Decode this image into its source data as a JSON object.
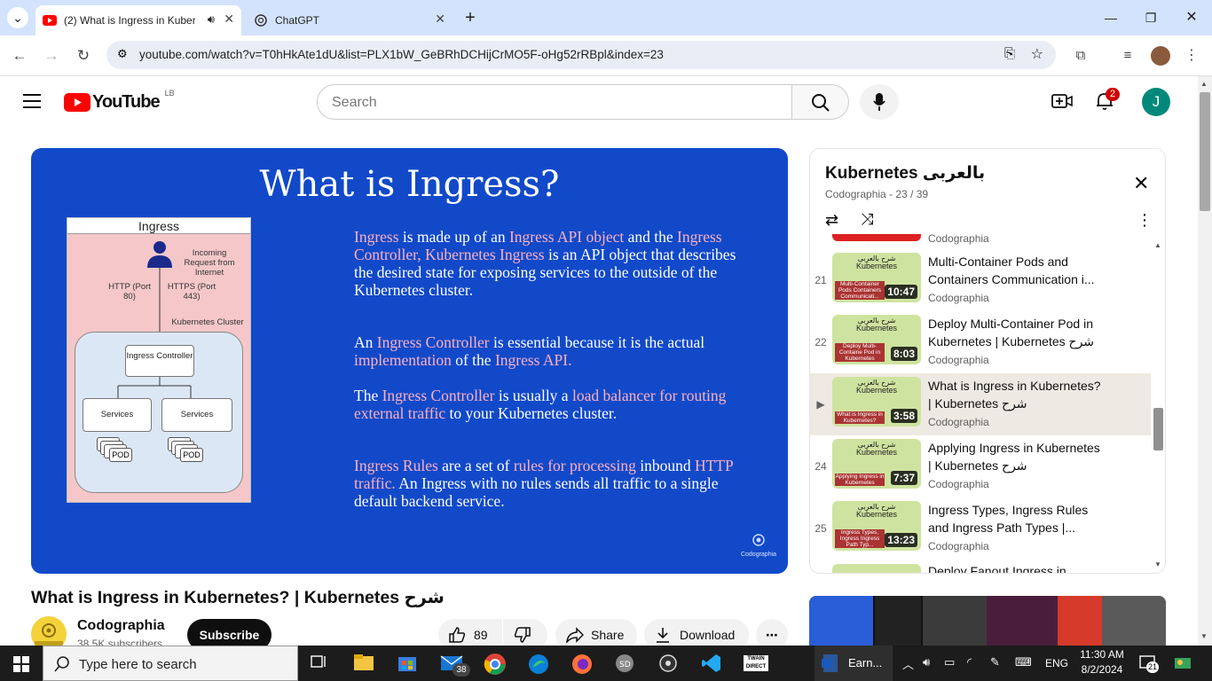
{
  "browser": {
    "tabs": [
      {
        "title": "(2) What is Ingress in Kuber",
        "active": true
      },
      {
        "title": "ChatGPT",
        "active": false
      }
    ],
    "url": "youtube.com/watch?v=T0hHkAte1dU&list=PLX1bW_GeBRhDCHijCrMO5F-oHg52rRBpl&index=23"
  },
  "youtube": {
    "logo_text": "YouTube",
    "region": "LB",
    "search_placeholder": "Search",
    "notifications_count": "2",
    "account_initial": "J"
  },
  "slide": {
    "title": "What is Ingress?",
    "diagram": {
      "header": "Ingress",
      "incoming": "Incoming Request from Internet",
      "http": "HTTP (Port 80)",
      "https": "HTTPS (Port 443)",
      "cluster": "Kubernetes Cluster",
      "controller": "Ingress Controller",
      "services": "Services",
      "pod": "POD"
    },
    "paragraphs": [
      [
        {
          "t": "Ingress",
          "h": true
        },
        {
          "t": " is made up of an ",
          "h": false
        },
        {
          "t": "Ingress API object",
          "h": true
        },
        {
          "t": " and the ",
          "h": false
        },
        {
          "t": "Ingress Controller, Kubernetes Ingress",
          "h": true
        },
        {
          "t": " is an API object that describes the desired state for exposing services to the outside of the Kubernetes cluster.",
          "h": false
        }
      ],
      [
        {
          "t": "An ",
          "h": false
        },
        {
          "t": "Ingress Controller",
          "h": true
        },
        {
          "t": " is essential because it is the actual ",
          "h": false
        },
        {
          "t": "implementation",
          "h": true
        },
        {
          "t": " of the ",
          "h": false
        },
        {
          "t": "Ingress API.",
          "h": true
        }
      ],
      [
        {
          "t": "The ",
          "h": false
        },
        {
          "t": "Ingress Controller",
          "h": true
        },
        {
          "t": " is usually a ",
          "h": false
        },
        {
          "t": "load balancer for routing external traffic",
          "h": true
        },
        {
          "t": " to your Kubernetes cluster.",
          "h": false
        }
      ],
      [
        {
          "t": "Ingress Rules",
          "h": true
        },
        {
          "t": " are a set of ",
          "h": false
        },
        {
          "t": "rules for processing",
          "h": true
        },
        {
          "t": " inbound ",
          "h": false
        },
        {
          "t": "HTTP traffic.",
          "h": true
        },
        {
          "t": " An Ingress with no rules sends all traffic to a single default backend service.",
          "h": false
        }
      ]
    ],
    "watermark": "Codographia"
  },
  "video": {
    "title": "What is Ingress in Kubernetes? | Kubernetes شرح",
    "channel": "Codographia",
    "subscribers": "38.5K subscribers",
    "subscribe_label": "Subscribe",
    "likes": "89",
    "share_label": "Share",
    "download_label": "Download"
  },
  "playlist": {
    "title": "Kubernetes بالعربى",
    "subtitle": "Codographia - 23 / 39",
    "partial_top_channel": "Codographia",
    "items": [
      {
        "index": "21",
        "title": "Multi-Container Pods and Containers Communication i...",
        "channel": "Codographia",
        "duration": "10:47",
        "thumb_caption": "Multi-Container Pods Containers Communicati..."
      },
      {
        "index": "22",
        "title": "Deploy Multi-Container Pod in Kubernetes | Kubernetes شرح",
        "channel": "Codographia",
        "duration": "8:03",
        "thumb_caption": "Deploy Multi-Containe Pod in Kubernetes"
      },
      {
        "index": "▶",
        "title": "What is Ingress in Kubernetes? | Kubernetes شرح",
        "channel": "Codographia",
        "duration": "3:58",
        "thumb_caption": "What is Ingress in Kubernetes?",
        "current": true
      },
      {
        "index": "24",
        "title": "Applying Ingress in Kubernetes | Kubernetes شرح",
        "channel": "Codographia",
        "duration": "7:37",
        "thumb_caption": "Applying Ingress in Kubernetes"
      },
      {
        "index": "25",
        "title": "Ingress Types, Ingress Rules and Ingress Path Types |...",
        "channel": "Codographia",
        "duration": "13:23",
        "thumb_caption": "Ingress Types, Ingress Ingress Path Typ..."
      }
    ],
    "partial_bottom_title": "Deploy Fanout Ingress in",
    "thumb_top_text": "شرح بالعربى",
    "thumb_sub_text": "Kubernetes"
  },
  "taskbar": {
    "search_placeholder": "Type here to search",
    "mail_badge": "38",
    "word_label": "Earn...",
    "language": "ENG",
    "time": "11:30 AM",
    "date": "8/2/2024",
    "notification_count": "21"
  },
  "colors": {
    "youtube_red": "#ff0000",
    "slide_blue": "#1149c9",
    "slide_highlight": "#ffb0c4",
    "chrome_tabbar": "#d3e3fd"
  }
}
